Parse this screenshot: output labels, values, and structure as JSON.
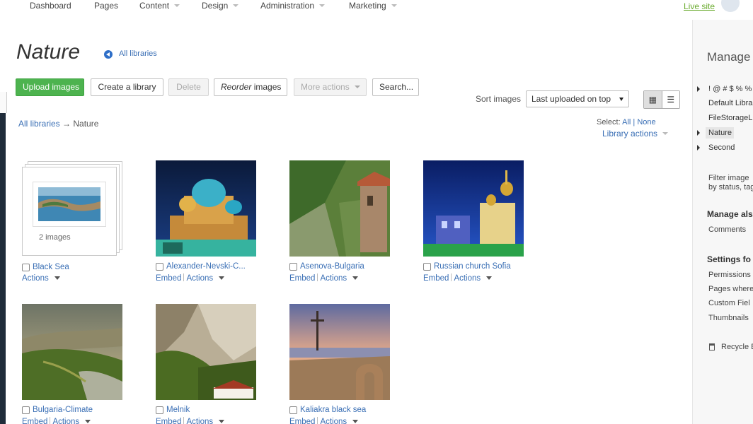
{
  "nav": {
    "items": [
      {
        "label": "Dashboard",
        "has_menu": false
      },
      {
        "label": "Pages",
        "has_menu": false
      },
      {
        "label": "Content",
        "has_menu": true
      },
      {
        "label": "Design",
        "has_menu": true
      },
      {
        "label": "Administration",
        "has_menu": true
      },
      {
        "label": "Marketing",
        "has_menu": true
      }
    ],
    "live_site": "Live site"
  },
  "header": {
    "title": "Nature",
    "back_link": "All libraries"
  },
  "toolbar": {
    "upload": "Upload images",
    "create": "Create a library",
    "delete": "Delete",
    "reorder_em": "Reorder",
    "reorder_rest": " images",
    "more": "More actions",
    "search": "Search..."
  },
  "sort": {
    "label": "Sort images",
    "value": "Last uploaded on top"
  },
  "breadcrumb": {
    "root": "All libraries",
    "arrow": " → ",
    "current": "Nature"
  },
  "selection": {
    "label": "Select:",
    "all": "All",
    "divider": "|",
    "none": "None",
    "library_actions": "Library actions"
  },
  "folder": {
    "name": "Black Sea",
    "count": "2 images",
    "actions": "Actions"
  },
  "images": [
    {
      "name": "Alexander-Nevski-C...",
      "embed": "Embed",
      "actions": "Actions"
    },
    {
      "name": "Asenova-Bulgaria",
      "embed": "Embed",
      "actions": "Actions"
    },
    {
      "name": "Russian church Sofia",
      "embed": "Embed",
      "actions": "Actions"
    },
    {
      "name": "Bulgaria-Climate",
      "embed": "Embed",
      "actions": "Actions"
    },
    {
      "name": "Melnik",
      "embed": "Embed",
      "actions": "Actions"
    },
    {
      "name": "Kaliakra black sea",
      "embed": "Embed",
      "actions": "Actions"
    }
  ],
  "sidebar": {
    "title": "Manage l",
    "libraries": [
      "! @ # $ % % ?",
      "Default Libra",
      "FileStorageLi",
      "Nature",
      "Second"
    ],
    "filter_line1": "Filter image",
    "filter_line2": "by status, tag",
    "manage_also": "Manage als",
    "comments": "Comments",
    "settings_for": "Settings fo",
    "settings_items": [
      "Permissions",
      "Pages where",
      "Custom Fiel",
      "Thumbnails"
    ],
    "recycle": "Recycle B"
  }
}
